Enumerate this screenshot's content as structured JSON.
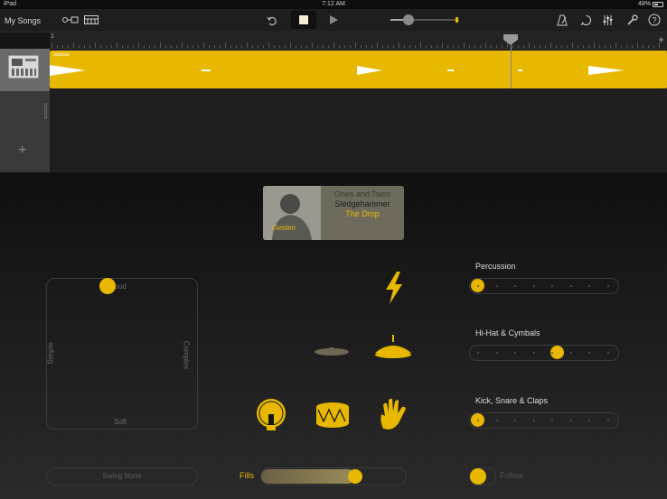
{
  "status": {
    "device": "iPad",
    "time": "7:12 AM",
    "battery": "48%",
    "battery_level": 0.48
  },
  "toolbar": {
    "my_songs": "My Songs",
    "icons": [
      "tracks-view-icon",
      "keyboard-icon",
      "undo-icon",
      "stop-icon",
      "play-icon",
      "volume-slider",
      "metronome-icon",
      "loop-browser-icon",
      "mixer-icon",
      "settings-wrench-icon",
      "help-icon"
    ]
  },
  "ruler": {
    "start_bar": "1"
  },
  "track": {
    "region_name": "ssssss"
  },
  "drummer": {
    "style": "Ones and Twos",
    "song": "Sledgehammer",
    "name": "The Drop",
    "signature": "Gesten"
  },
  "pad": {
    "top": "Loud",
    "bottom": "Soft",
    "left": "Simple",
    "right": "Complex"
  },
  "sliders": [
    {
      "label": "Percussion",
      "value": 0
    },
    {
      "label": "Hi-Hat & Cymbals",
      "value": 0.6
    },
    {
      "label": "Kick, Snare & Claps",
      "value": 0
    }
  ],
  "swing": {
    "label": "Swing None"
  },
  "fills": {
    "label": "Fills",
    "value": 0.65
  },
  "follow": {
    "label": "Follow"
  },
  "colors": {
    "accent": "#e8b800",
    "background": "#161616"
  }
}
